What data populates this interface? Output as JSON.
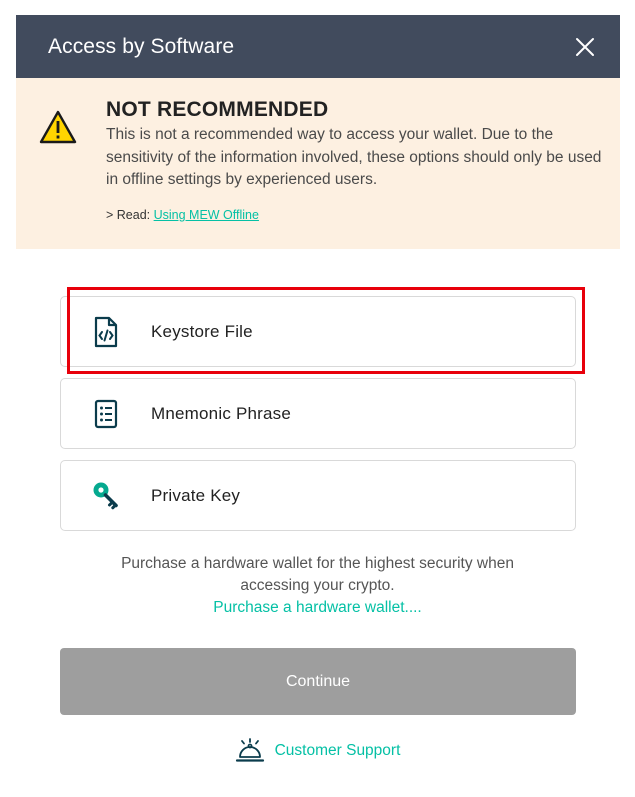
{
  "header": {
    "title": "Access by Software",
    "close_icon": "close-icon"
  },
  "warning": {
    "icon": "warning-triangle-icon",
    "title": "NOT RECOMMENDED",
    "body": "This is not a recommended way to access your wallet. Due to the sensitivity of the information involved, these options should only be used in offline settings by experienced users.",
    "read_prefix": "> Read: ",
    "read_link": "Using MEW Offline"
  },
  "options": [
    {
      "label": "Keystore File",
      "icon": "keystore-file-icon",
      "highlighted": true
    },
    {
      "label": "Mnemonic Phrase",
      "icon": "mnemonic-list-icon",
      "highlighted": false
    },
    {
      "label": "Private Key",
      "icon": "key-icon",
      "highlighted": false
    }
  ],
  "purchase": {
    "line1": "Purchase a hardware wallet for the highest security when",
    "line2": "accessing your crypto.",
    "link": "Purchase a hardware wallet...."
  },
  "continue_label": "Continue",
  "support": {
    "label": "Customer Support",
    "icon": "service-bell-icon"
  },
  "colors": {
    "header_bg": "#414b5d",
    "warning_bg": "#fdf0e1",
    "accent": "#05c0a5",
    "highlight": "#e8000b",
    "continue_bg": "#9e9e9e",
    "icon_dark": "#0b3c4c"
  }
}
